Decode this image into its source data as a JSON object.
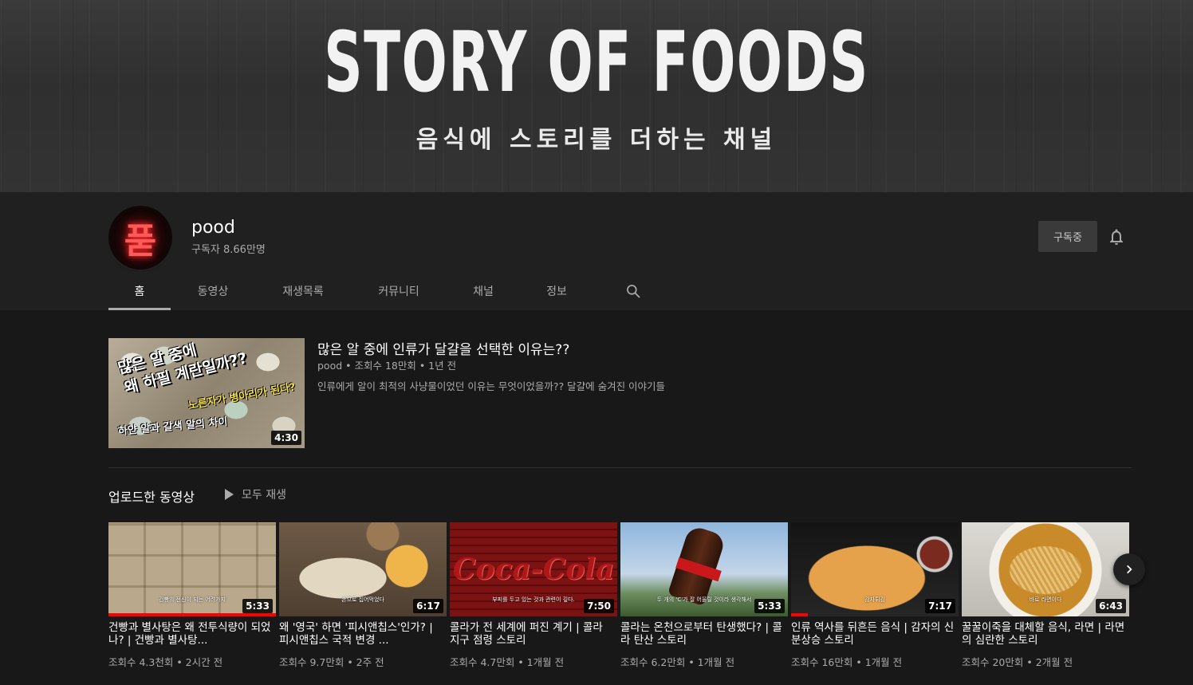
{
  "banner": {
    "title": "STORY OF FOODS",
    "subtitle": "음식에 스토리를 더하는 채널"
  },
  "channel": {
    "avatar_glyph": "푿",
    "name": "pood",
    "subscribers": "구독자 8.66만명",
    "subscribe_button": "구독중"
  },
  "tabs": [
    {
      "label": "홈",
      "active": true
    },
    {
      "label": "동영상"
    },
    {
      "label": "재생목록"
    },
    {
      "label": "커뮤니티"
    },
    {
      "label": "채널"
    },
    {
      "label": "정보"
    }
  ],
  "featured": {
    "thumb_text_1": "많은 알 중에",
    "thumb_text_2": "왜 하필 계란일까??",
    "thumb_text_3": "노른자가 병아리가 된다?",
    "thumb_text_4": "하얀 알과 갈색 알의 차이",
    "duration": "4:30",
    "title": "많은 알 중에 인류가 달걀을 선택한 이유는??",
    "meta": "pood • 조회수 18만회 • 1년 전",
    "description": "인류에게 알이 최적의 사냥물이었던 이유는 무엇이었을까?? 달걀에 숨겨진 이야기들"
  },
  "uploads": {
    "title": "업로드한 동영상",
    "play_all": "모두 재생",
    "videos": [
      {
        "title": "건빵과 별사탕은 왜 전투식량이 되었나? | 건빵과 별사탕...",
        "meta": "조회수 4.3천회 • 2시간 전",
        "duration": "5:33",
        "caption": "건빵의 전신이 되는 어려가지",
        "progress": 1.0
      },
      {
        "title": "왜 '영국' 하면 '피시앤칩스'인가? | 피시앤칩스 국적 변경 ...",
        "meta": "조회수 9.7만회 • 2주 전",
        "duration": "6:17",
        "caption": "손으로 집어먹었다"
      },
      {
        "title": "콜라가 전 세계에 퍼진 계기 | 콜라 지구 점령 스토리",
        "meta": "조회수 4.7만회 • 1개월 전",
        "duration": "7:50",
        "caption": "부피를 두고 있는 것과 관련이 깊다."
      },
      {
        "title": "콜라는 온천으로부터 탄생했다? | 콜라 탄산 스토리",
        "meta": "조회수 6.2만회 • 1개월 전",
        "duration": "5:33",
        "caption": "두 개의 'C'가 잘 어울릴 것이라 생각해서"
      },
      {
        "title": "인류 역사를 뒤흔든 음식 | 감자의 신분상승 스토리",
        "meta": "조회수 16만회 • 1개월 전",
        "duration": "7:17",
        "caption": "감자튀김",
        "progress": 0.1
      },
      {
        "title": "꿀꿀이죽을 대체할 음식, 라면 | 라면의 심란한 스토리",
        "meta": "조회수 20만회 • 2개월 전",
        "duration": "6:43",
        "caption": "바로 라면이다"
      }
    ]
  },
  "colors": {
    "background": "#181818",
    "header": "#202020",
    "progress": "#ff0000"
  },
  "icons": [
    "bell-icon",
    "search-icon",
    "play-icon",
    "chevron-right-icon"
  ]
}
